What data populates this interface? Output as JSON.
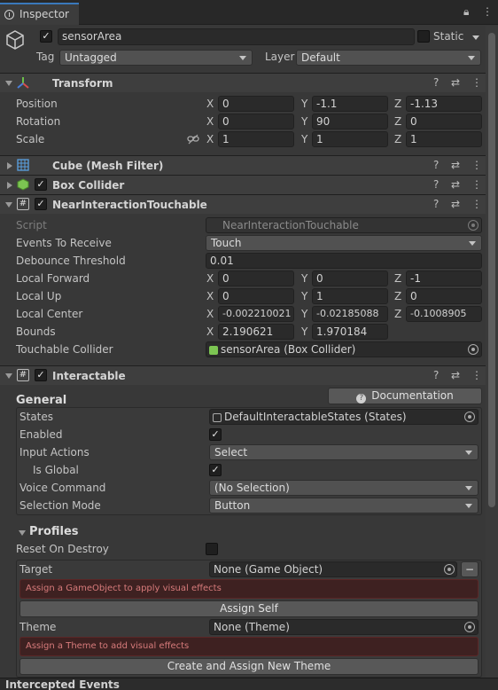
{
  "tab": {
    "title": "Inspector",
    "lock_icon": "lock-icon",
    "menu_icon": "kebab-menu-icon"
  },
  "gameobject": {
    "name": "sensorArea",
    "active": true,
    "static_label": "Static",
    "tag_label": "Tag",
    "tag_value": "Untagged",
    "layer_label": "Layer",
    "layer_value": "Default"
  },
  "transform": {
    "title": "Transform",
    "position_label": "Position",
    "rotation_label": "Rotation",
    "scale_label": "Scale",
    "position": [
      "0",
      "-1.1",
      "-1.13"
    ],
    "rotation": [
      "0",
      "90",
      "0"
    ],
    "scale": [
      "1",
      "1",
      "1"
    ]
  },
  "axes": {
    "x": "X",
    "y": "Y",
    "z": "Z"
  },
  "components": {
    "mesh_filter": "Cube (Mesh Filter)",
    "box_collider": "Box Collider"
  },
  "nit": {
    "title": "NearInteractionTouchable",
    "script_label": "Script",
    "script_value": "NearInteractionTouchable",
    "events_label": "Events To Receive",
    "events_value": "Touch",
    "debounce_label": "Debounce Threshold",
    "debounce_value": "0.01",
    "forward_label": "Local Forward",
    "forward": [
      "0",
      "0",
      "-1"
    ],
    "up_label": "Local Up",
    "up": [
      "0",
      "1",
      "0"
    ],
    "center_label": "Local Center",
    "center": [
      "-0.002210021",
      "-0.02185088",
      "-0.1008905"
    ],
    "bounds_label": "Bounds",
    "bounds": [
      "2.190621",
      "1.970184"
    ],
    "collider_label": "Touchable Collider",
    "collider_value": "sensorArea (Box Collider)"
  },
  "interactable": {
    "title": "Interactable",
    "doc_button": "Documentation",
    "general": "General",
    "states_label": "States",
    "states_value": "DefaultInteractableStates (States)",
    "enabled_label": "Enabled",
    "input_label": "Input Actions",
    "input_value": "Select",
    "global_label": "Is Global",
    "voice_label": "Voice Command",
    "voice_value": "(No Selection)",
    "selmode_label": "Selection Mode",
    "selmode_value": "Button",
    "profiles": "Profiles",
    "reset_label": "Reset On Destroy",
    "target_label": "Target",
    "target_value": "None (Game Object)",
    "minus": "−",
    "target_error": "Assign a GameObject to apply visual effects",
    "assign_self": "Assign Self",
    "theme_label": "Theme",
    "theme_value": "None (Theme)",
    "theme_error": "Assign a Theme to add visual effects",
    "create_theme": "Create and Assign New Theme"
  },
  "footer": {
    "title": "Intercepted Events"
  },
  "check": "✓",
  "colors": {
    "background": "#383838",
    "header": "#3e3e3e",
    "field": "#2a2a2a",
    "error_text": "#d77b7b",
    "tab_accent": "#3a79bb"
  }
}
